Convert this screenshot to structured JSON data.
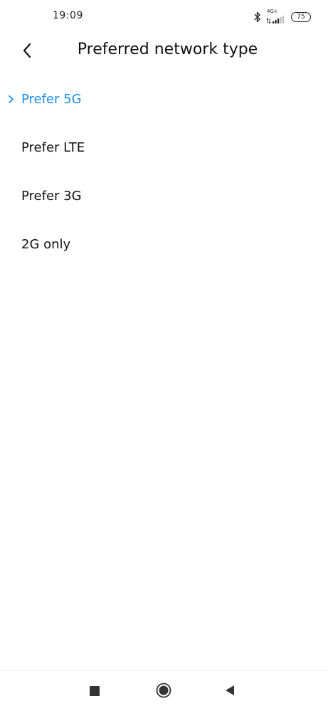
{
  "status_bar": {
    "time": "19:09",
    "network_label": "4G+",
    "battery_level": "75",
    "icons": [
      "bluetooth-icon",
      "signal-icon",
      "battery-icon"
    ]
  },
  "header": {
    "title": "Preferred network type",
    "back_icon": "chevron-left-icon"
  },
  "options": [
    {
      "label": "Prefer 5G",
      "selected": true
    },
    {
      "label": "Prefer LTE",
      "selected": false
    },
    {
      "label": "Prefer 3G",
      "selected": false
    },
    {
      "label": "2G only",
      "selected": false
    }
  ],
  "nav_bar": {
    "icons": [
      "recent-apps-icon",
      "home-icon",
      "back-triangle-icon"
    ]
  },
  "colors": {
    "accent": "#1a8ee6",
    "text": "#111111",
    "background": "#ffffff"
  }
}
